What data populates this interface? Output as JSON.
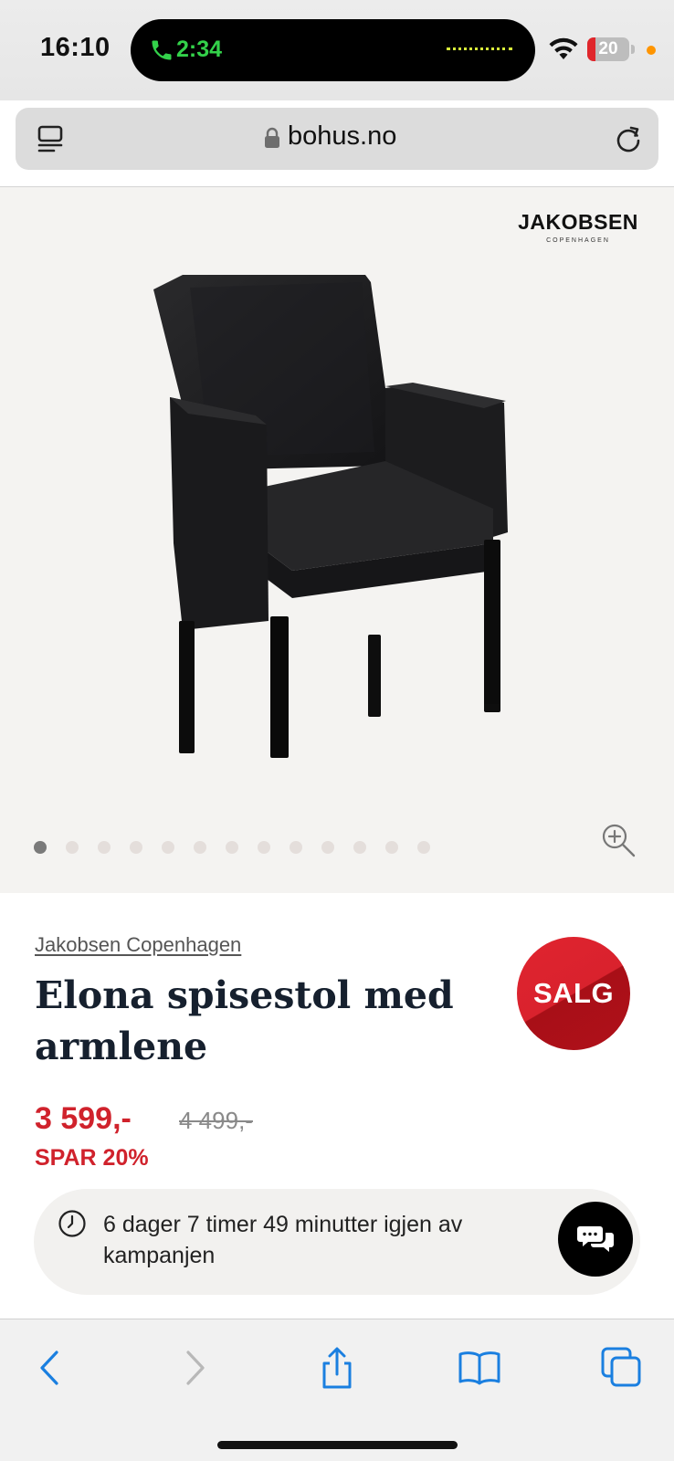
{
  "status_bar": {
    "time": "16:10",
    "call_time": "2:34",
    "battery": "20",
    "battery_level": 0.2,
    "icons": [
      "phone-icon",
      "wifi-icon",
      "battery-icon"
    ]
  },
  "browser": {
    "url": "bohus.no",
    "icons": [
      "reader-icon",
      "lock-icon",
      "reload-icon"
    ]
  },
  "gallery": {
    "brand_logo_main": "JAKOBSEN",
    "brand_logo_sub": "COPENHAGEN",
    "image_count": 13,
    "active_index": 0
  },
  "product": {
    "brand": "Jakobsen Copenhagen",
    "title": "Elona spisestol med armlene",
    "sale_badge": "SALG",
    "price": "3 599,-",
    "old_price": "4 499,-",
    "savings": "SPAR 20%",
    "campaign_text": "6 dager 7 timer 49 minutter igjen av kampanjen"
  },
  "colors": {
    "sale_red": "#d0222c",
    "title_navy": "#16202e",
    "link_blue": "#1a7fe0"
  },
  "toolbar": {
    "icons": [
      "back-icon",
      "forward-icon",
      "share-icon",
      "bookmarks-icon",
      "tabs-icon"
    ]
  }
}
